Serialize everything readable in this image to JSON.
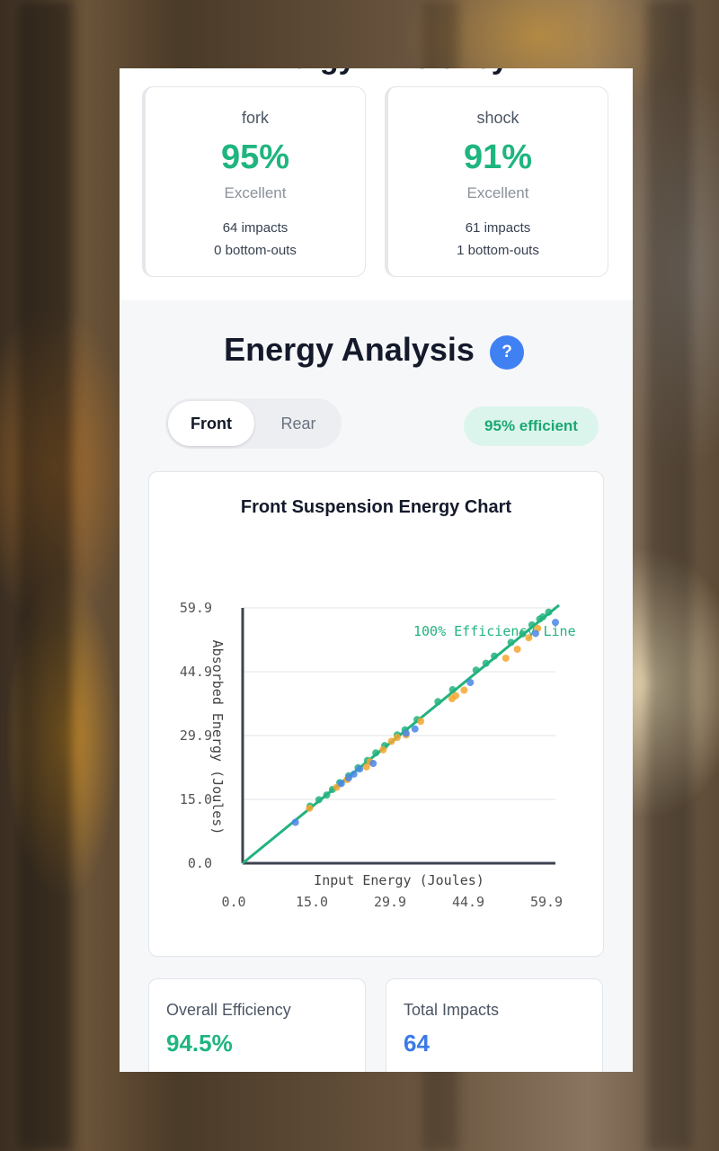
{
  "header": {
    "partial_title": "Energy Efficiency"
  },
  "components": [
    {
      "name": "fork",
      "percent": "95%",
      "rating": "Excellent",
      "impacts": "64 impacts",
      "bottom_outs": "0 bottom-outs"
    },
    {
      "name": "shock",
      "percent": "91%",
      "rating": "Excellent",
      "impacts": "61 impacts",
      "bottom_outs": "1 bottom-outs"
    }
  ],
  "energy_analysis": {
    "title": "Energy Analysis",
    "help_icon_glyph": "?",
    "tabs": [
      {
        "label": "Front",
        "selected": true
      },
      {
        "label": "Rear",
        "selected": false
      }
    ],
    "efficiency_badge": "95% efficient"
  },
  "chart_data": {
    "type": "scatter",
    "title": "Front Suspension Energy Chart",
    "xlabel": "Input Energy (Joules)",
    "ylabel": "Absorbed Energy (Joules)",
    "xlim": [
      0,
      59.9
    ],
    "ylim": [
      0,
      59.9
    ],
    "x_ticks": [
      "0.0",
      "15.0",
      "29.9",
      "44.9",
      "59.9"
    ],
    "y_ticks": [
      "0.0",
      "15.0",
      "29.9",
      "44.9",
      "59.9"
    ],
    "grid": true,
    "reference_line": {
      "label": "100% Efficiency Line",
      "from": [
        0,
        0
      ],
      "to": [
        59.9,
        59.9
      ],
      "color": "#22b37e"
    },
    "series": [
      {
        "color": "#22b37e",
        "points": [
          [
            12.9,
            13.4
          ],
          [
            14.6,
            14.9
          ],
          [
            16.1,
            16.0
          ],
          [
            17.2,
            17.3
          ],
          [
            18.6,
            18.9
          ],
          [
            20.3,
            20.5
          ],
          [
            22.1,
            22.4
          ],
          [
            23.9,
            24.1
          ],
          [
            25.5,
            25.9
          ],
          [
            27.2,
            27.6
          ],
          [
            29.6,
            30.1
          ],
          [
            31.1,
            31.3
          ],
          [
            33.4,
            33.7
          ],
          [
            37.4,
            37.9
          ],
          [
            40.2,
            40.7
          ],
          [
            44.7,
            45.3
          ],
          [
            46.6,
            46.9
          ],
          [
            48.2,
            48.6
          ],
          [
            51.4,
            51.8
          ],
          [
            53.6,
            53.8
          ],
          [
            55.4,
            55.9
          ],
          [
            56.9,
            57.3
          ],
          [
            57.5,
            57.8
          ],
          [
            58.6,
            58.9
          ]
        ]
      },
      {
        "color": "#f5a630",
        "points": [
          [
            12.8,
            12.9
          ],
          [
            18.0,
            17.8
          ],
          [
            20.0,
            19.6
          ],
          [
            23.7,
            22.6
          ],
          [
            24.4,
            23.8
          ],
          [
            26.9,
            26.6
          ],
          [
            28.5,
            28.6
          ],
          [
            29.6,
            29.5
          ],
          [
            31.3,
            30.1
          ],
          [
            34.1,
            33.3
          ],
          [
            40.1,
            38.6
          ],
          [
            40.8,
            39.3
          ],
          [
            42.4,
            40.6
          ],
          [
            50.4,
            48.1
          ],
          [
            52.6,
            50.2
          ],
          [
            54.8,
            52.9
          ],
          [
            56.5,
            55.1
          ]
        ]
      },
      {
        "color": "#4a86e8",
        "points": [
          [
            10.1,
            9.6
          ],
          [
            18.9,
            18.7
          ],
          [
            20.3,
            20.0
          ],
          [
            21.3,
            20.9
          ],
          [
            22.4,
            22.1
          ],
          [
            25.0,
            23.4
          ],
          [
            31.3,
            30.5
          ],
          [
            33.0,
            31.5
          ],
          [
            43.6,
            42.4
          ],
          [
            56.1,
            53.9
          ],
          [
            59.9,
            56.5
          ]
        ]
      }
    ]
  },
  "stats": [
    {
      "label": "Overall Efficiency",
      "value": "94.5%",
      "color": "#1fb57f"
    },
    {
      "label": "Total Impacts",
      "value": "64",
      "color": "#3b7ae8"
    }
  ]
}
